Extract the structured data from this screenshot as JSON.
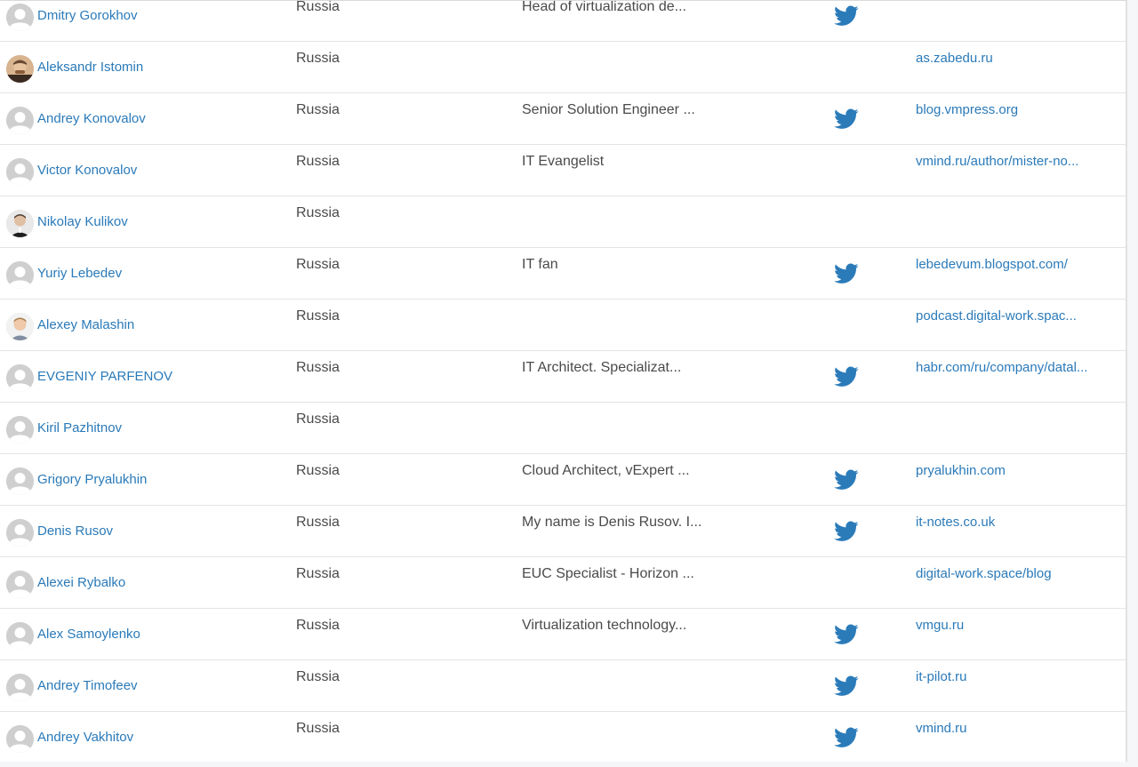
{
  "colors": {
    "link": "#2a7ab9",
    "text": "#4a4a4a",
    "twitter": "#2b7bb9",
    "divider": "#e4e4e4"
  },
  "people": [
    {
      "name": "Dmitry Gorokhov",
      "country": "Russia",
      "bio": "Head of virtualization de...",
      "twitter": true,
      "site": "",
      "avatar": "default-avatar-icon"
    },
    {
      "name": "Aleksandr Istomin",
      "country": "Russia",
      "bio": "",
      "twitter": false,
      "site": "as.zabedu.ru",
      "avatar": "photo-avatar"
    },
    {
      "name": "Andrey Konovalov",
      "country": "Russia",
      "bio": "Senior Solution Engineer ...",
      "twitter": true,
      "site": "blog.vmpress.org",
      "avatar": "default-avatar-icon"
    },
    {
      "name": "Victor Konovalov",
      "country": "Russia",
      "bio": "IT Evangelist",
      "twitter": false,
      "site": "vmind.ru/author/mister-no...",
      "avatar": "default-avatar-icon"
    },
    {
      "name": "Nikolay Kulikov",
      "country": "Russia",
      "bio": "",
      "twitter": false,
      "site": "",
      "avatar": "photo-avatar"
    },
    {
      "name": "Yuriy Lebedev",
      "country": "Russia",
      "bio": "IT fan",
      "twitter": true,
      "site": "lebedevum.blogspot.com/",
      "avatar": "default-avatar-icon"
    },
    {
      "name": "Alexey Malashin",
      "country": "Russia",
      "bio": "",
      "twitter": false,
      "site": "podcast.digital-work.spac...",
      "avatar": "photo-avatar"
    },
    {
      "name": "EVGENIY PARFENOV",
      "country": "Russia",
      "bio": "IT Architect. Specializat...",
      "twitter": true,
      "site": "habr.com/ru/company/datal...",
      "avatar": "default-avatar-icon"
    },
    {
      "name": "Kiril Pazhitnov",
      "country": "Russia",
      "bio": "",
      "twitter": false,
      "site": "",
      "avatar": "default-avatar-icon"
    },
    {
      "name": "Grigory Pryalukhin",
      "country": "Russia",
      "bio": "Cloud Architect, vExpert ...",
      "twitter": true,
      "site": "pryalukhin.com",
      "avatar": "default-avatar-icon"
    },
    {
      "name": "Denis Rusov",
      "country": "Russia",
      "bio": "My name is Denis Rusov. I...",
      "twitter": true,
      "site": "it-notes.co.uk",
      "avatar": "default-avatar-icon"
    },
    {
      "name": "Alexei Rybalko",
      "country": "Russia",
      "bio": "EUC Specialist - Horizon ...",
      "twitter": false,
      "site": "digital-work.space/blog",
      "avatar": "default-avatar-icon"
    },
    {
      "name": "Alex Samoylenko",
      "country": "Russia",
      "bio": "Virtualization technology...",
      "twitter": true,
      "site": "vmgu.ru",
      "avatar": "default-avatar-icon"
    },
    {
      "name": "Andrey Timofeev",
      "country": "Russia",
      "bio": "",
      "twitter": true,
      "site": "it-pilot.ru",
      "avatar": "default-avatar-icon"
    },
    {
      "name": "Andrey Vakhitov",
      "country": "Russia",
      "bio": "",
      "twitter": true,
      "site": "vmind.ru",
      "avatar": "default-avatar-icon"
    }
  ]
}
